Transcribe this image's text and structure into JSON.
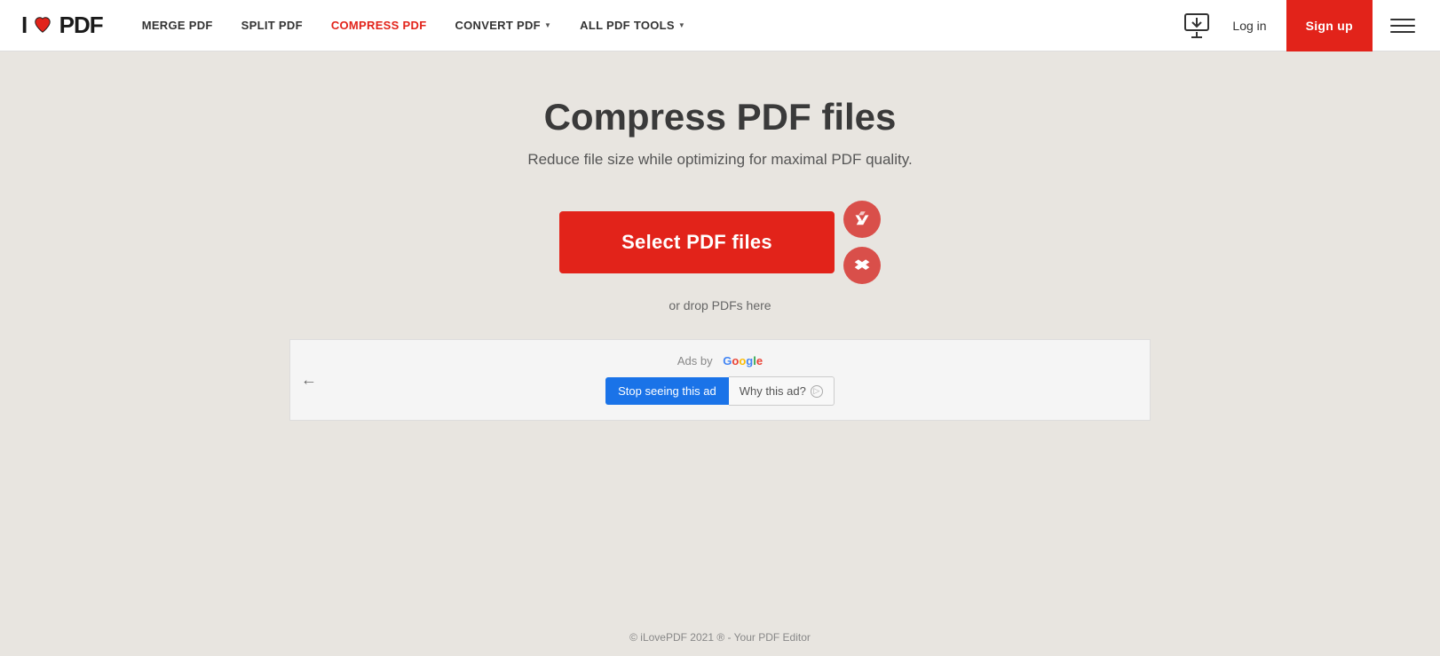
{
  "brand": {
    "name_pre": "I",
    "name_post": "PDF",
    "heart": "♥"
  },
  "nav": {
    "items": [
      {
        "label": "MERGE PDF",
        "active": false,
        "dropdown": false
      },
      {
        "label": "SPLIT PDF",
        "active": false,
        "dropdown": false
      },
      {
        "label": "COMPRESS PDF",
        "active": true,
        "dropdown": false
      },
      {
        "label": "CONVERT PDF",
        "active": false,
        "dropdown": true
      },
      {
        "label": "ALL PDF TOOLS",
        "active": false,
        "dropdown": true
      }
    ],
    "login_label": "Log in",
    "signup_label": "Sign up"
  },
  "main": {
    "title": "Compress PDF files",
    "subtitle": "Reduce file size while optimizing for maximal PDF quality.",
    "select_btn": "Select PDF files",
    "drop_text": "or drop PDFs here"
  },
  "ad": {
    "ads_by": "Ads by",
    "google_label": "Google",
    "stop_seeing": "Stop seeing this ad",
    "why_this_ad": "Why this ad?"
  },
  "footer": {
    "text": "© iLovePDF 2021 ® - Your PDF Editor"
  }
}
